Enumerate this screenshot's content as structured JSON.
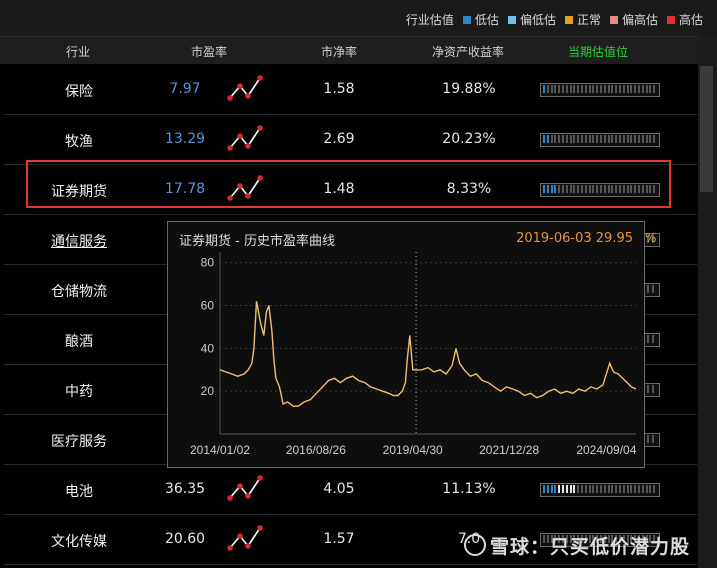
{
  "legend": {
    "label": "行业估值",
    "items": [
      {
        "label": "低估",
        "color": "#2f86c8"
      },
      {
        "label": "偏低估",
        "color": "#6cc0e8"
      },
      {
        "label": "正常",
        "color": "#e8a020"
      },
      {
        "label": "偏高估",
        "color": "#e88a8a"
      },
      {
        "label": "高估",
        "color": "#e03030"
      }
    ]
  },
  "headers": {
    "industry": "行业",
    "pe": "市盈率",
    "pb": "市净率",
    "roe": "净资产收益率",
    "current": "当期估值位"
  },
  "header_current_color": "#33cc33",
  "rows": [
    {
      "name": "保险",
      "pe": "7.97",
      "pb": "1.58",
      "roe": "19.88%",
      "level": 0.03,
      "linked": false
    },
    {
      "name": "牧渔",
      "pe": "13.29",
      "pb": "2.69",
      "roe": "20.23%",
      "level": 0.08,
      "linked": false
    },
    {
      "name": "证券期货",
      "pe": "17.78",
      "pb": "1.48",
      "roe": "8.33%",
      "level": 0.12,
      "linked": false
    },
    {
      "name": "通信服务",
      "pe": "",
      "pb": "",
      "roe": "",
      "level": 0,
      "linked": true
    },
    {
      "name": "仓储物流",
      "pe": "",
      "pb": "",
      "roe": "",
      "level": 0,
      "linked": false
    },
    {
      "name": "酿酒",
      "pe": "",
      "pb": "",
      "roe": "",
      "level": 0,
      "linked": false
    },
    {
      "name": "中药",
      "pe": "",
      "pb": "",
      "roe": "",
      "level": 0,
      "linked": false
    },
    {
      "name": "医疗服务",
      "pe": "",
      "pb": "",
      "roe": "",
      "level": 0,
      "linked": false
    },
    {
      "name": "电池",
      "pe": "36.35",
      "pb": "4.05",
      "roe": "11.13%",
      "level": 0.12,
      "linked": false
    },
    {
      "name": "文化传媒",
      "pe": "20.60",
      "pb": "1.57",
      "roe": "7.0",
      "level": 0,
      "linked": false
    }
  ],
  "popup": {
    "title": "证券期货 - 历史市盈率曲线",
    "hover_date": "2019-06-03",
    "hover_value": "29.95"
  },
  "peek_text": "%",
  "watermark": "雪球：只买低价潜力股",
  "chart_data": {
    "type": "line",
    "title": "证券期货 - 历史市盈率曲线",
    "xlabel": "",
    "ylabel": "",
    "ylim": [
      0,
      85
    ],
    "yticks": [
      20,
      40,
      60,
      80
    ],
    "xticks": [
      "2014/01/02",
      "2016/08/26",
      "2019/04/30",
      "2021/12/28",
      "2024/09/04"
    ],
    "xrange": [
      "2014/01/02",
      "2025/06/30"
    ],
    "grid": true,
    "cursor_date": "2019/06/03",
    "line_color": "#f0c070",
    "series": [
      {
        "x": [
          "2014/01/02",
          "2014/03/01",
          "2014/05/01",
          "2014/07/01",
          "2014/09/01",
          "2014/10/15",
          "2014/11/20",
          "2014/12/10",
          "2015/01/05",
          "2015/02/15",
          "2015/03/20",
          "2015/04/15",
          "2015/05/10",
          "2015/06/10",
          "2015/07/01",
          "2015/07/20",
          "2015/08/25",
          "2015/10/01",
          "2015/11/15",
          "2016/01/10",
          "2016/03/01",
          "2016/05/01",
          "2016/07/01",
          "2016/09/01",
          "2016/11/01",
          "2017/01/01",
          "2017/03/01",
          "2017/05/01",
          "2017/07/01",
          "2017/09/01",
          "2017/11/01",
          "2018/01/01",
          "2018/03/01",
          "2018/05/01",
          "2018/07/01",
          "2018/09/01",
          "2018/10/15",
          "2018/12/01",
          "2019/01/15",
          "2019/02/15",
          "2019/03/07",
          "2019/04/01",
          "2019/05/01",
          "2019/06/03",
          "2019/08/01",
          "2019/10/01",
          "2019/12/01",
          "2020/02/01",
          "2020/04/01",
          "2020/06/01",
          "2020/07/10",
          "2020/08/15",
          "2020/10/01",
          "2020/12/01",
          "2021/02/01",
          "2021/04/01",
          "2021/06/01",
          "2021/08/01",
          "2021/10/01",
          "2021/12/01",
          "2022/02/01",
          "2022/04/01",
          "2022/06/01",
          "2022/08/01",
          "2022/10/01",
          "2022/12/01",
          "2023/02/01",
          "2023/04/01",
          "2023/06/01",
          "2023/08/01",
          "2023/10/01",
          "2023/12/01",
          "2024/02/01",
          "2024/04/01",
          "2024/06/01",
          "2024/08/01",
          "2024/10/08",
          "2024/11/15",
          "2025/01/01",
          "2025/02/15",
          "2025/04/01",
          "2025/05/15",
          "2025/06/30"
        ],
        "y": [
          30,
          29,
          28,
          27,
          28,
          30,
          33,
          40,
          62,
          52,
          46,
          57,
          60,
          48,
          34,
          26,
          22,
          14,
          15,
          13,
          13,
          15,
          16,
          19,
          22,
          25,
          26,
          24,
          26,
          27,
          25,
          24,
          22,
          21,
          20,
          19,
          18,
          18,
          20,
          24,
          35,
          46,
          30,
          29.95,
          30,
          31,
          29,
          30,
          28,
          32,
          40,
          33,
          30,
          27,
          28,
          25,
          24,
          22,
          20,
          22,
          21,
          20,
          18,
          19,
          17,
          18,
          20,
          21,
          19,
          20,
          19,
          21,
          20,
          22,
          21,
          23,
          33,
          29,
          28,
          26,
          24,
          22,
          21
        ]
      }
    ]
  }
}
